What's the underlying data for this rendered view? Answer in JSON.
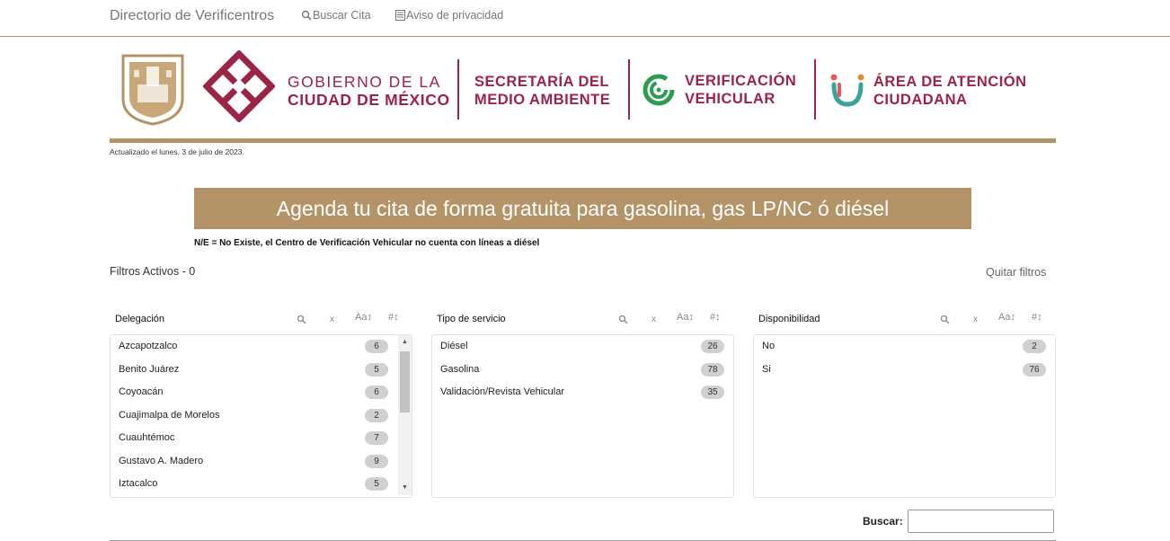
{
  "nav": {
    "brand": "Directorio de Verificentros",
    "search_link": "Buscar Cita",
    "privacy_link": "Aviso de privacidad"
  },
  "header": {
    "gob_line1": "GOBIERNO DE LA",
    "gob_line2": "CIUDAD DE MÉXICO",
    "sedema_line1": "SECRETARÍA DEL",
    "sedema_line2": "MEDIO AMBIENTE",
    "verif_line1": "VERIFICACIÓN",
    "verif_line2": "VEHICULAR",
    "area_line1": "ÁREA DE ATENCIÓN",
    "area_line2": "CIUDADANA"
  },
  "updated": "Actualizado el lunes, 3 de julio de 2023.",
  "banner": "Agenda tu cita de forma gratuita para gasolina, gas LP/NC ó diésel",
  "note": "N/E = No Existe, el Centro de Verificación Vehicular no cuenta con líneas a diésel",
  "filters_active": "Filtros Activos - 0",
  "clear_filters": "Quitar filtros",
  "panels": {
    "delegacion": {
      "title": "Delegación",
      "items": [
        {
          "label": "Azcapotzalco",
          "count": "6"
        },
        {
          "label": "Benito Juárez",
          "count": "5"
        },
        {
          "label": "Coyoacán",
          "count": "6"
        },
        {
          "label": "Cuajimalpa de Morelos",
          "count": "2"
        },
        {
          "label": "Cuauhtémoc",
          "count": "7"
        },
        {
          "label": "Gustavo A. Madero",
          "count": "9"
        },
        {
          "label": "Iztacalco",
          "count": "5"
        }
      ]
    },
    "tipo": {
      "title": "Tipo de servicio",
      "items": [
        {
          "label": "Diésel",
          "count": "26"
        },
        {
          "label": "Gasolina",
          "count": "78"
        },
        {
          "label": "Validación/Revista Vehicular",
          "count": "35"
        }
      ]
    },
    "disponibilidad": {
      "title": "Disponibilidad",
      "items": [
        {
          "label": "No",
          "count": "2"
        },
        {
          "label": "Si",
          "count": "76"
        }
      ]
    }
  },
  "panel_icons": {
    "clear": "x",
    "sort_alpha": "A",
    "sort_num": "#"
  },
  "search_label": "Buscar:",
  "colors": {
    "gold": "#b49367",
    "wine": "#9c2447",
    "green": "#2e9b52"
  }
}
